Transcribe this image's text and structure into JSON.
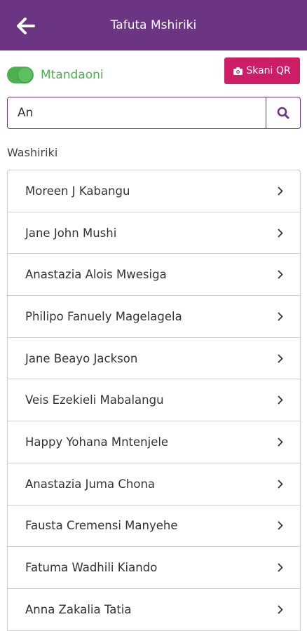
{
  "header": {
    "title": "Tafuta Mshiriki",
    "background": "#6b3584"
  },
  "online_toggle": {
    "label": "Mtandaoni",
    "on": true,
    "color": "#4caf50"
  },
  "qr_button": {
    "label": "Skani QR",
    "icon": "camera-icon",
    "color": "#cc1d66"
  },
  "search": {
    "value": "An",
    "icon": "search-icon"
  },
  "participants": {
    "heading": "Washiriki",
    "items": [
      {
        "name": "Moreen J Kabangu"
      },
      {
        "name": "Jane John Mushi"
      },
      {
        "name": "Anastazia Alois Mwesiga"
      },
      {
        "name": "Philipo Fanuely Magelagela"
      },
      {
        "name": "Jane Beayo Jackson"
      },
      {
        "name": "Veis Ezekieli Mabalangu"
      },
      {
        "name": "Happy Yohana Mntenjele"
      },
      {
        "name": "Anastazia Juma Chona"
      },
      {
        "name": "Fausta Cremensi Manyehe"
      },
      {
        "name": "Fatuma Wadhili Kiando"
      },
      {
        "name": "Anna Zakalia Tatia"
      }
    ]
  }
}
